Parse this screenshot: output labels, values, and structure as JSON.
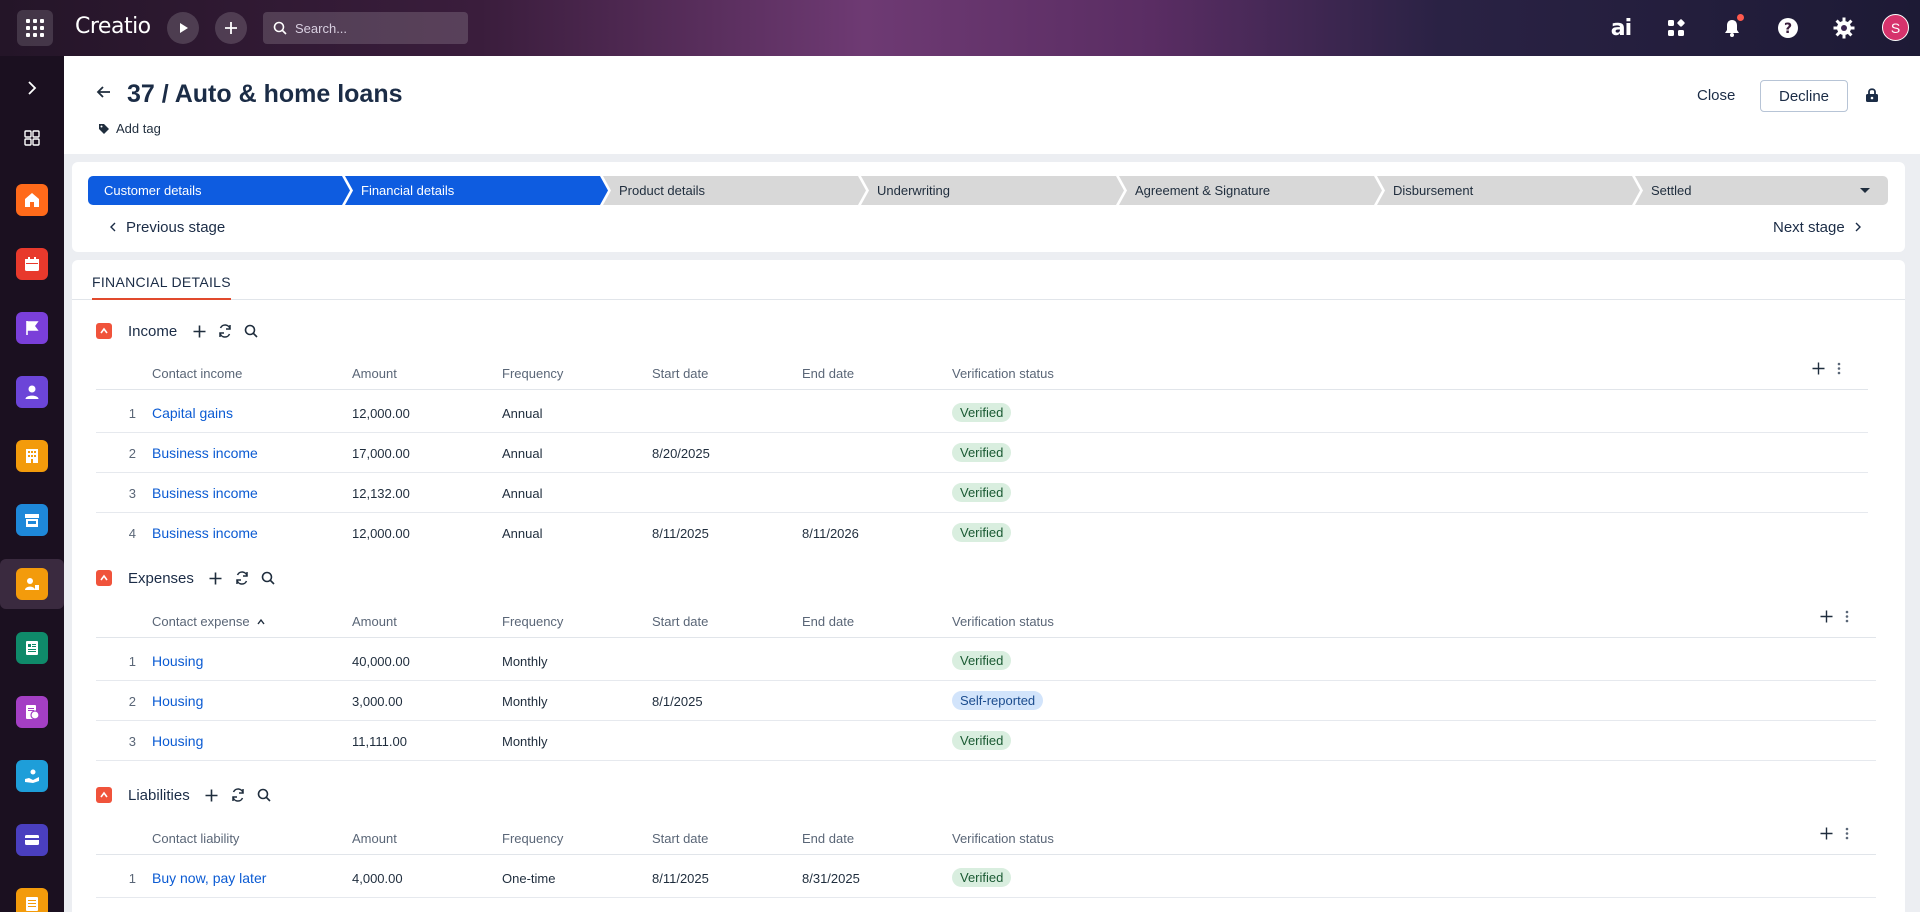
{
  "topbar": {
    "logo": "Creatio",
    "search_placeholder": "Search...",
    "ai_label": "ai",
    "avatar_initial": "S"
  },
  "header": {
    "title": "37 / Auto & home loans",
    "add_tag": "Add tag",
    "close_label": "Close",
    "decline_label": "Decline"
  },
  "stages": {
    "items": [
      "Customer details",
      "Financial details",
      "Product details",
      "Underwriting",
      "Agreement & Signature",
      "Disbursement",
      "Settled"
    ],
    "previous_label": "Previous stage",
    "next_label": "Next stage"
  },
  "tab": {
    "label": "FINANCIAL DETAILS"
  },
  "columns": {
    "amount": "Amount",
    "frequency": "Frequency",
    "start_date": "Start date",
    "end_date": "End date",
    "verification_status": "Verification status"
  },
  "income": {
    "title": "Income",
    "first_column": "Contact income",
    "rows": [
      {
        "num": "1",
        "name": "Capital gains",
        "amount": "12,000.00",
        "frequency": "Annual",
        "start": "",
        "end": "",
        "status": "Verified"
      },
      {
        "num": "2",
        "name": "Business income",
        "amount": "17,000.00",
        "frequency": "Annual",
        "start": "8/20/2025",
        "end": "",
        "status": "Verified"
      },
      {
        "num": "3",
        "name": "Business income",
        "amount": "12,132.00",
        "frequency": "Annual",
        "start": "",
        "end": "",
        "status": "Verified"
      },
      {
        "num": "4",
        "name": "Business income",
        "amount": "12,000.00",
        "frequency": "Annual",
        "start": "8/11/2025",
        "end": "8/11/2026",
        "status": "Verified"
      }
    ]
  },
  "expenses": {
    "title": "Expenses",
    "first_column": "Contact expense",
    "rows": [
      {
        "num": "1",
        "name": "Housing",
        "amount": "40,000.00",
        "frequency": "Monthly",
        "start": "",
        "end": "",
        "status": "Verified"
      },
      {
        "num": "2",
        "name": "Housing",
        "amount": "3,000.00",
        "frequency": "Monthly",
        "start": "8/1/2025",
        "end": "",
        "status": "Self-reported"
      },
      {
        "num": "3",
        "name": "Housing",
        "amount": "11,111.00",
        "frequency": "Monthly",
        "start": "",
        "end": "",
        "status": "Verified"
      }
    ]
  },
  "liabilities": {
    "title": "Liabilities",
    "first_column": "Contact liability",
    "rows": [
      {
        "num": "1",
        "name": "Buy now, pay later",
        "amount": "4,000.00",
        "frequency": "One-time",
        "start": "8/11/2025",
        "end": "8/31/2025",
        "status": "Verified"
      }
    ]
  },
  "colors": {
    "stage_done": "#0e5ce0",
    "stage_todo": "#d8d8d8",
    "accent": "#f0533b",
    "link": "#0b5bd3"
  }
}
